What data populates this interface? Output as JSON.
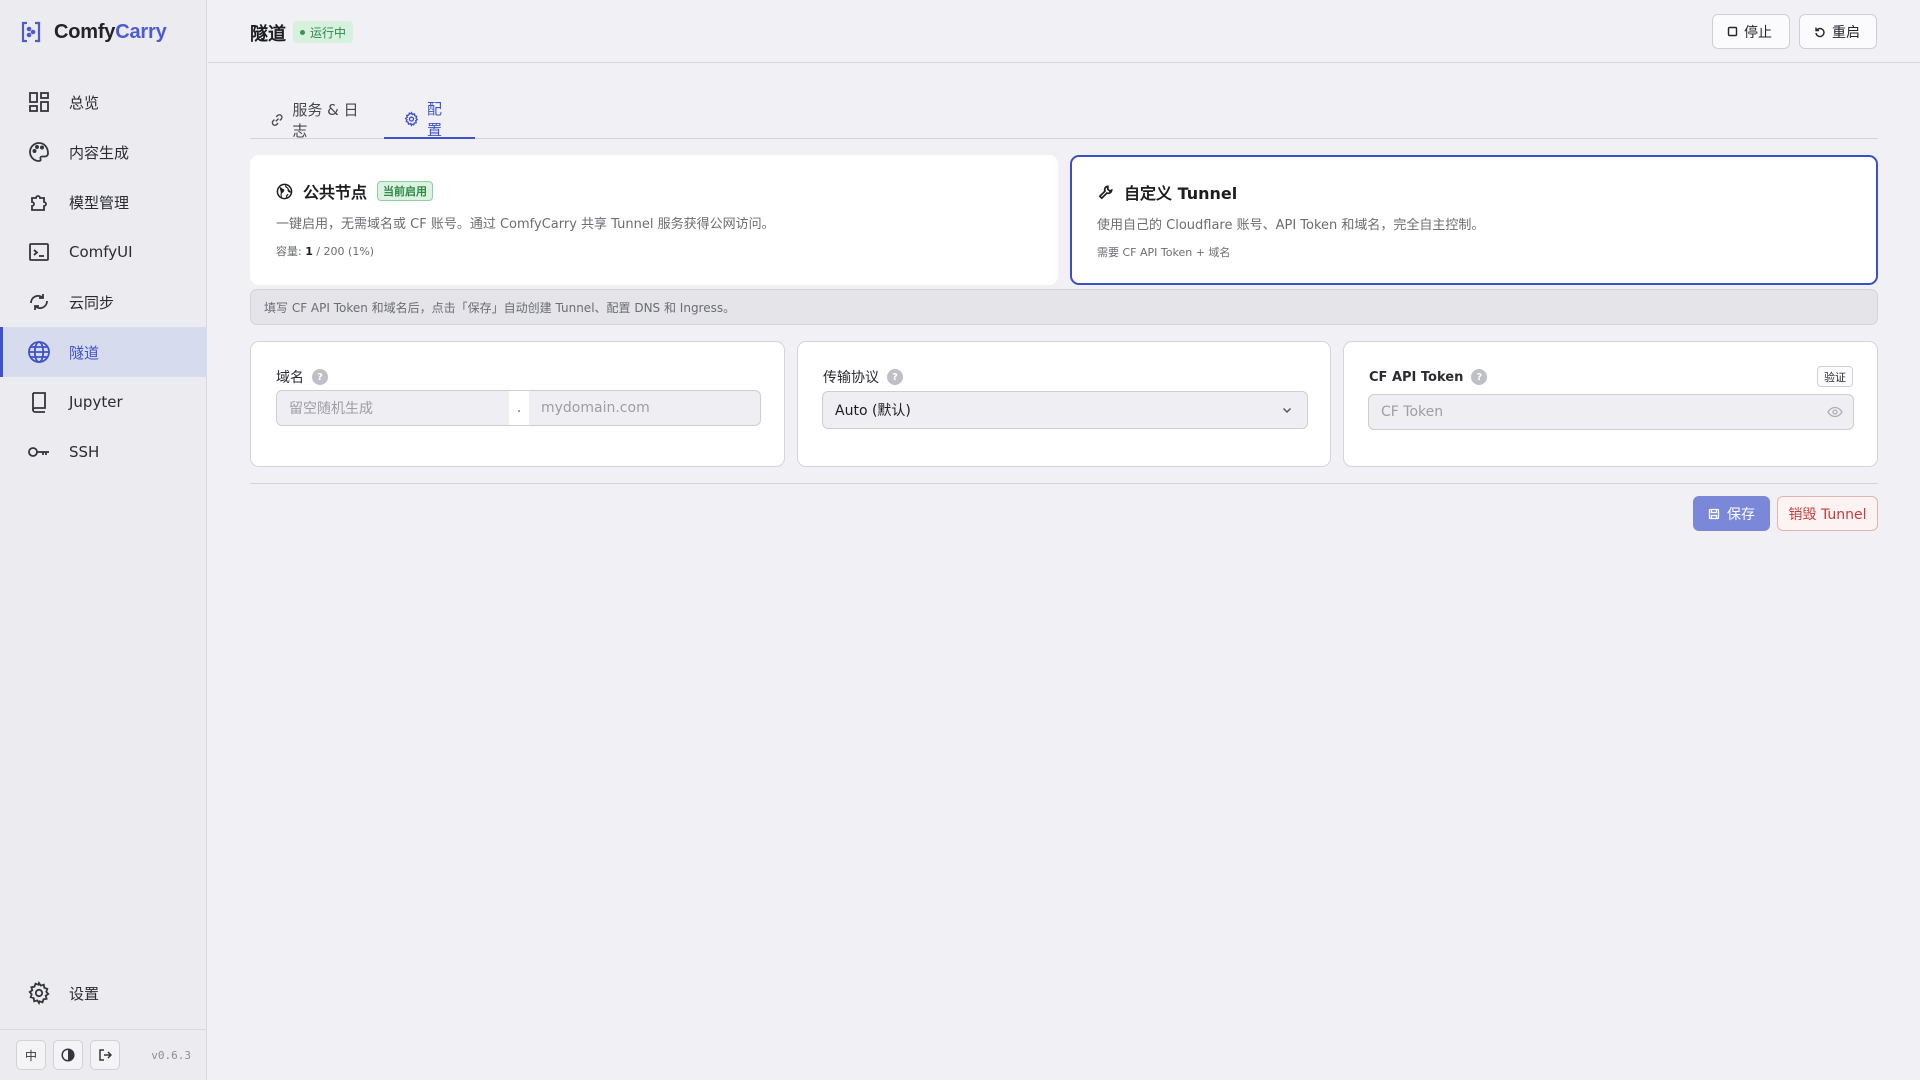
{
  "brand": {
    "name_part1": "Comfy",
    "name_part2": "Carry"
  },
  "sidebar": {
    "items": [
      {
        "label": "总览",
        "icon": "dashboard-icon"
      },
      {
        "label": "内容生成",
        "icon": "palette-icon"
      },
      {
        "label": "模型管理",
        "icon": "puzzle-icon"
      },
      {
        "label": "ComfyUI",
        "icon": "terminal-icon"
      },
      {
        "label": "云同步",
        "icon": "cloud-sync-icon"
      },
      {
        "label": "隧道",
        "icon": "globe-icon",
        "active": true
      },
      {
        "label": "Jupyter",
        "icon": "book-icon"
      },
      {
        "label": "SSH",
        "icon": "key-icon"
      }
    ],
    "settings_label": "设置",
    "lang_label": "中",
    "version": "v0.6.3"
  },
  "header": {
    "title": "隧道",
    "status": "运行中",
    "stop_label": "停止",
    "restart_label": "重启"
  },
  "tabs": [
    {
      "label": "服务 & 日志",
      "icon": "link-icon"
    },
    {
      "label": "配置",
      "icon": "gear-icon",
      "active": true
    }
  ],
  "modes": {
    "public": {
      "title": "公共节点",
      "tag": "当前启用",
      "desc": "一键启用，无需域名或 CF 账号。通过 ComfyCarry 共享 Tunnel 服务获得公网访问。",
      "capacity_label": "容量: ",
      "capacity_used": "1",
      "capacity_rest": " / 200 (1%)"
    },
    "custom": {
      "title": "自定义 Tunnel",
      "desc": "使用自己的 Cloudflare 账号、API Token 和域名，完全自主控制。",
      "meta": "需要 CF API Token + 域名"
    }
  },
  "hint": "填写 CF API Token 和域名后，点击「保存」自动创建 Tunnel、配置 DNS 和 Ingress。",
  "fields": {
    "domain": {
      "label": "域名",
      "help": "?",
      "subdomain_placeholder": "留空随机生成",
      "sep": ".",
      "root_placeholder": "mydomain.com"
    },
    "protocol": {
      "label": "传输协议",
      "help": "?",
      "value": "Auto (默认)"
    },
    "token": {
      "label": "CF API Token",
      "help": "?",
      "verify_label": "验证",
      "placeholder": "CF Token"
    }
  },
  "actions": {
    "save_label": "保存",
    "destroy_label": "销毁 Tunnel"
  },
  "colors": {
    "accent": "#4052c9",
    "success": "#2d8a47",
    "danger": "#c43c3c"
  }
}
